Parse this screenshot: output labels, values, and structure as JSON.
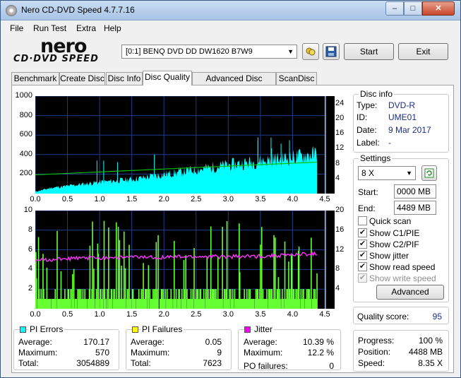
{
  "window": {
    "title": "Nero CD-DVD Speed 4.7.7.16",
    "minimize": "–",
    "maximize": "□",
    "close": "✕"
  },
  "menu": [
    "File",
    "Run Test",
    "Extra",
    "Help"
  ],
  "logo": {
    "top": "nero",
    "bottom": "CD·DVD SPEED"
  },
  "drive": {
    "selected": "[0:1]   BENQ DVD DD DW1620 B7W9"
  },
  "toolbar": {
    "start_label": "Start",
    "exit_label": "Exit",
    "refresh_icon": "refresh-icon",
    "save_icon": "save-icon"
  },
  "tabs": [
    "Benchmark",
    "Create Disc",
    "Disc Info",
    "Disc Quality",
    "Advanced Disc Quality",
    "ScanDisc"
  ],
  "active_tab": "Disc Quality",
  "chart_data": [
    {
      "type": "area",
      "name_hint": "PI errors with read speed",
      "x_ticks": [
        "0.0",
        "0.5",
        "1.0",
        "1.5",
        "2.0",
        "2.5",
        "3.0",
        "3.5",
        "4.0",
        "4.5"
      ],
      "xlim": [
        0,
        4.5
      ],
      "y_left_ticks": [
        "1000",
        "800",
        "600",
        "400",
        "200"
      ],
      "ylim_left": [
        0,
        1000
      ],
      "y_right_ticks": [
        "24",
        "20",
        "16",
        "12",
        "8",
        "4"
      ],
      "ylim_right": [
        0,
        26
      ],
      "grid": true,
      "series": [
        {
          "color": "#00ffff",
          "x": [
            0.0,
            0.25,
            0.5,
            1.0,
            1.5,
            2.0,
            2.5,
            3.0,
            3.5,
            4.0,
            4.2,
            4.38
          ],
          "values": [
            20,
            60,
            80,
            120,
            150,
            200,
            250,
            300,
            340,
            380,
            400,
            420
          ]
        },
        {
          "color": "#00c000",
          "x": [
            0.0,
            4.38
          ],
          "values": [
            5.0,
            8.4
          ]
        }
      ]
    },
    {
      "type": "bar",
      "name_hint": "PI failures with jitter",
      "x_ticks": [
        "0.0",
        "0.5",
        "1.0",
        "1.5",
        "2.0",
        "2.5",
        "3.0",
        "3.5",
        "4.0",
        "4.5"
      ],
      "xlim": [
        0,
        4.5
      ],
      "y_left_ticks": [
        "10",
        "8",
        "6",
        "4",
        "2"
      ],
      "ylim_left": [
        0,
        10
      ],
      "y_right_ticks": [
        "20",
        "16",
        "12",
        "8",
        "4"
      ],
      "ylim_right": [
        0,
        20
      ],
      "grid": true,
      "series": [
        {
          "color": "#66ff33",
          "x": [
            0.0,
            4.38
          ],
          "values": [
            1,
            1
          ]
        },
        {
          "color": "#ff33ff",
          "x": [
            0.0,
            0.5,
            1.0,
            1.5,
            2.0,
            2.5,
            3.0,
            3.5,
            4.0,
            4.38
          ],
          "values": [
            9.8,
            10.2,
            10.4,
            10.5,
            10.5,
            10.6,
            10.6,
            10.7,
            11.0,
            11.2
          ]
        }
      ]
    }
  ],
  "disc_info": {
    "title": "Disc info",
    "rows": [
      {
        "label": "Type:",
        "value": "DVD-R"
      },
      {
        "label": "ID:",
        "value": "UME01"
      },
      {
        "label": "Date:",
        "value": "9 Mar 2017"
      },
      {
        "label": "Label:",
        "value": "-"
      }
    ]
  },
  "settings": {
    "title": "Settings",
    "speed": "8 X",
    "start_label": "Start:",
    "start_value": "0000 MB",
    "end_label": "End:",
    "end_value": "4489 MB",
    "checks": [
      {
        "label": "Quick scan",
        "checked": false,
        "disabled": false
      },
      {
        "label": "Show C1/PIE",
        "checked": true,
        "disabled": false
      },
      {
        "label": "Show C2/PIF",
        "checked": true,
        "disabled": false
      },
      {
        "label": "Show jitter",
        "checked": true,
        "disabled": false
      },
      {
        "label": "Show read speed",
        "checked": true,
        "disabled": false
      },
      {
        "label": "Show write speed",
        "checked": true,
        "disabled": true
      }
    ],
    "advanced_label": "Advanced"
  },
  "quality": {
    "label": "Quality score:",
    "value": "95"
  },
  "progress": {
    "rows": [
      {
        "label": "Progress:",
        "value": "100 %"
      },
      {
        "label": "Position:",
        "value": "4488 MB"
      },
      {
        "label": "Speed:",
        "value": "8.35 X"
      }
    ]
  },
  "pi_errors": {
    "title": "PI Errors",
    "color": "#00ffff",
    "rows": [
      {
        "label": "Average:",
        "value": "170.17"
      },
      {
        "label": "Maximum:",
        "value": "570"
      },
      {
        "label": "Total:",
        "value": "3054889"
      }
    ]
  },
  "pi_failures": {
    "title": "PI Failures",
    "color": "#ffff00",
    "rows": [
      {
        "label": "Average:",
        "value": "0.05"
      },
      {
        "label": "Maximum:",
        "value": "9"
      },
      {
        "label": "Total:",
        "value": "7623"
      }
    ]
  },
  "jitter": {
    "title": "Jitter",
    "color": "#ff00ff",
    "rows": [
      {
        "label": "Average:",
        "value": "10.39 %"
      },
      {
        "label": "Maximum:",
        "value": "12.2 %"
      },
      {
        "label": "PO failures:",
        "value": "0"
      }
    ]
  }
}
